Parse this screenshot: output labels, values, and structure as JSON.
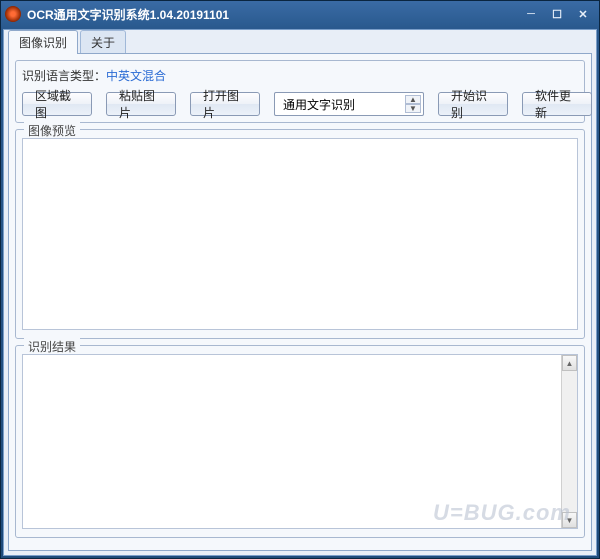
{
  "window": {
    "title": "OCR通用文字识别系统1.04.20191101"
  },
  "tabs": {
    "image_recognition": "图像识别",
    "about": "关于"
  },
  "lang": {
    "label": "识别语言类型：",
    "value": "中英文混合"
  },
  "toolbar": {
    "region_capture": "区域截图",
    "paste_image": "粘贴图片",
    "open_image": "打开图片",
    "start_recognition": "开始识别",
    "software_update": "软件更新"
  },
  "combo": {
    "selected": "通用文字识别"
  },
  "groups": {
    "preview": "图像预览",
    "result": "识别结果"
  },
  "watermark": "U=BUG.com"
}
